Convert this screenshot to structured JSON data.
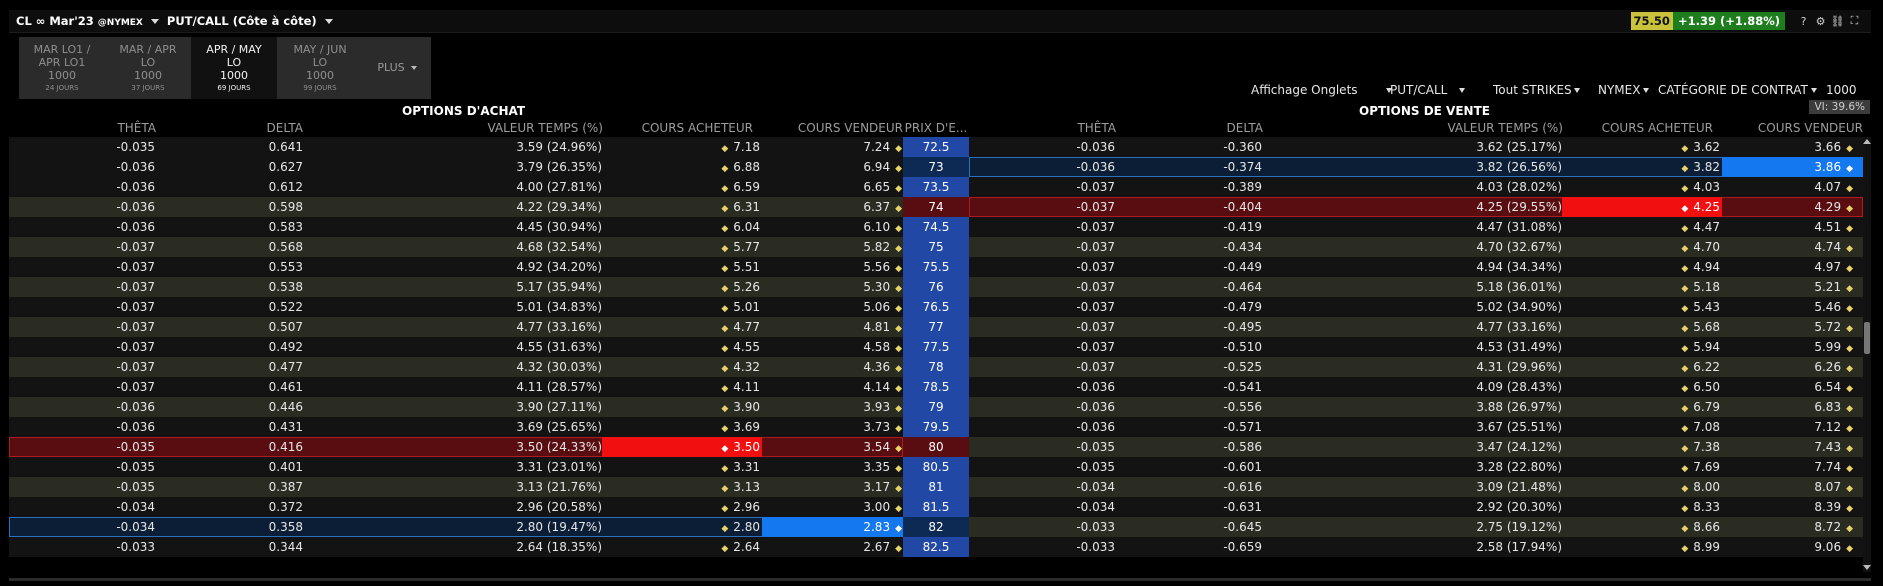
{
  "title_bar": {
    "symbol": "CL ∞ Mar'23",
    "exchange": "@NYMEX",
    "mode": "PUT/CALL (Côte à côte)",
    "last_price": "75.50",
    "change": "+1.39 (+1.88%)",
    "icons": [
      "help-icon",
      "settings-icon",
      "link-icon",
      "expand-icon"
    ],
    "help_glyph": "?",
    "settings_glyph": "⚙",
    "link_glyph": "⛓",
    "expand_glyph": "⛶"
  },
  "tabs": [
    {
      "line1": "MAR LO1 /",
      "line2": "APR LO1",
      "size": "1000",
      "days": "24 JOURS",
      "active": false
    },
    {
      "line1": "MAR / APR",
      "line2": "LO",
      "size": "1000",
      "days": "37 JOURS",
      "active": false
    },
    {
      "line1": "APR / MAY",
      "line2": "LO",
      "size": "1000",
      "days": "69 JOURS",
      "active": true
    },
    {
      "line1": "MAY / JUN",
      "line2": "LO",
      "size": "1000",
      "days": "99 JOURS",
      "active": false
    }
  ],
  "more_tab": "PLUS",
  "controls": {
    "display": "Affichage Onglets",
    "type": "PUT/CALL",
    "strikes": "Tout STRIKES",
    "exchange": "NYMEX",
    "category": "CATÉGORIE DE CONTRAT",
    "size": "1000"
  },
  "headers": {
    "calls_title": "OPTIONS D'ACHAT",
    "puts_title": "OPTIONS DE VENTE",
    "vi": "VI: 39.6%",
    "strike": "PRIX D'E...",
    "theta": "THÊTA",
    "delta": "DELTA",
    "time_value": "VALEUR TEMPS (%)",
    "bid": "COURS ACHETEUR",
    "ask": "COURS VENDEUR"
  },
  "colors": {
    "strike_bg": "#2148a4",
    "highlight_red": "#f20f0f",
    "highlight_blue": "#1479f0",
    "price_box": "#c9c23a",
    "change_box": "#1e7e1e"
  },
  "rows": [
    {
      "strike": "72.5",
      "c_theta": "-0.035",
      "c_delta": "0.641",
      "c_tv": "3.59 (24.96%)",
      "c_bid": "7.18",
      "c_ask": "7.24",
      "p_theta": "-0.036",
      "p_delta": "-0.360",
      "p_tv": "3.62 (25.17%)",
      "p_bid": "3.62",
      "p_ask": "3.66"
    },
    {
      "strike": "73",
      "c_theta": "-0.036",
      "c_delta": "0.627",
      "c_tv": "3.79 (26.35%)",
      "c_bid": "6.88",
      "c_ask": "6.94",
      "p_theta": "-0.036",
      "p_delta": "-0.374",
      "p_tv": "3.82 (26.56%)",
      "p_bid": "3.82",
      "p_ask": "3.86",
      "row_state": "put-selected",
      "p_ask_highlight": "blue"
    },
    {
      "strike": "73.5",
      "c_theta": "-0.036",
      "c_delta": "0.612",
      "c_tv": "4.00 (27.81%)",
      "c_bid": "6.59",
      "c_ask": "6.65",
      "p_theta": "-0.037",
      "p_delta": "-0.389",
      "p_tv": "4.03 (28.02%)",
      "p_bid": "4.03",
      "p_ask": "4.07"
    },
    {
      "strike": "74",
      "c_theta": "-0.036",
      "c_delta": "0.598",
      "c_tv": "4.22 (29.34%)",
      "c_bid": "6.31",
      "c_ask": "6.37",
      "p_theta": "-0.037",
      "p_delta": "-0.404",
      "p_tv": "4.25 (29.55%)",
      "p_bid": "4.25",
      "p_ask": "4.29",
      "row_state": "put-red",
      "p_bid_highlight": "red"
    },
    {
      "strike": "74.5",
      "c_theta": "-0.036",
      "c_delta": "0.583",
      "c_tv": "4.45 (30.94%)",
      "c_bid": "6.04",
      "c_ask": "6.10",
      "p_theta": "-0.037",
      "p_delta": "-0.419",
      "p_tv": "4.47 (31.08%)",
      "p_bid": "4.47",
      "p_ask": "4.51"
    },
    {
      "strike": "75",
      "c_theta": "-0.037",
      "c_delta": "0.568",
      "c_tv": "4.68 (32.54%)",
      "c_bid": "5.77",
      "c_ask": "5.82",
      "p_theta": "-0.037",
      "p_delta": "-0.434",
      "p_tv": "4.70 (32.67%)",
      "p_bid": "4.70",
      "p_ask": "4.74"
    },
    {
      "strike": "75.5",
      "c_theta": "-0.037",
      "c_delta": "0.553",
      "c_tv": "4.92 (34.20%)",
      "c_bid": "5.51",
      "c_ask": "5.56",
      "p_theta": "-0.037",
      "p_delta": "-0.449",
      "p_tv": "4.94 (34.34%)",
      "p_bid": "4.94",
      "p_ask": "4.97"
    },
    {
      "strike": "76",
      "c_theta": "-0.037",
      "c_delta": "0.538",
      "c_tv": "5.17 (35.94%)",
      "c_bid": "5.26",
      "c_ask": "5.30",
      "p_theta": "-0.037",
      "p_delta": "-0.464",
      "p_tv": "5.18 (36.01%)",
      "p_bid": "5.18",
      "p_ask": "5.21"
    },
    {
      "strike": "76.5",
      "c_theta": "-0.037",
      "c_delta": "0.522",
      "c_tv": "5.01 (34.83%)",
      "c_bid": "5.01",
      "c_ask": "5.06",
      "p_theta": "-0.037",
      "p_delta": "-0.479",
      "p_tv": "5.02 (34.90%)",
      "p_bid": "5.43",
      "p_ask": "5.46"
    },
    {
      "strike": "77",
      "c_theta": "-0.037",
      "c_delta": "0.507",
      "c_tv": "4.77 (33.16%)",
      "c_bid": "4.77",
      "c_ask": "4.81",
      "p_theta": "-0.037",
      "p_delta": "-0.495",
      "p_tv": "4.77 (33.16%)",
      "p_bid": "5.68",
      "p_ask": "5.72"
    },
    {
      "strike": "77.5",
      "c_theta": "-0.037",
      "c_delta": "0.492",
      "c_tv": "4.55 (31.63%)",
      "c_bid": "4.55",
      "c_ask": "4.58",
      "p_theta": "-0.037",
      "p_delta": "-0.510",
      "p_tv": "4.53 (31.49%)",
      "p_bid": "5.94",
      "p_ask": "5.99"
    },
    {
      "strike": "78",
      "c_theta": "-0.037",
      "c_delta": "0.477",
      "c_tv": "4.32 (30.03%)",
      "c_bid": "4.32",
      "c_ask": "4.36",
      "p_theta": "-0.037",
      "p_delta": "-0.525",
      "p_tv": "4.31 (29.96%)",
      "p_bid": "6.22",
      "p_ask": "6.26"
    },
    {
      "strike": "78.5",
      "c_theta": "-0.037",
      "c_delta": "0.461",
      "c_tv": "4.11 (28.57%)",
      "c_bid": "4.11",
      "c_ask": "4.14",
      "p_theta": "-0.036",
      "p_delta": "-0.541",
      "p_tv": "4.09 (28.43%)",
      "p_bid": "6.50",
      "p_ask": "6.54"
    },
    {
      "strike": "79",
      "c_theta": "-0.036",
      "c_delta": "0.446",
      "c_tv": "3.90 (27.11%)",
      "c_bid": "3.90",
      "c_ask": "3.93",
      "p_theta": "-0.036",
      "p_delta": "-0.556",
      "p_tv": "3.88 (26.97%)",
      "p_bid": "6.79",
      "p_ask": "6.83"
    },
    {
      "strike": "79.5",
      "c_theta": "-0.036",
      "c_delta": "0.431",
      "c_tv": "3.69 (25.65%)",
      "c_bid": "3.69",
      "c_ask": "3.73",
      "p_theta": "-0.036",
      "p_delta": "-0.571",
      "p_tv": "3.67 (25.51%)",
      "p_bid": "7.08",
      "p_ask": "7.12"
    },
    {
      "strike": "80",
      "c_theta": "-0.035",
      "c_delta": "0.416",
      "c_tv": "3.50 (24.33%)",
      "c_bid": "3.50",
      "c_ask": "3.54",
      "p_theta": "-0.035",
      "p_delta": "-0.586",
      "p_tv": "3.47 (24.12%)",
      "p_bid": "7.38",
      "p_ask": "7.43",
      "row_state": "call-red",
      "c_bid_highlight": "red"
    },
    {
      "strike": "80.5",
      "c_theta": "-0.035",
      "c_delta": "0.401",
      "c_tv": "3.31 (23.01%)",
      "c_bid": "3.31",
      "c_ask": "3.35",
      "p_theta": "-0.035",
      "p_delta": "-0.601",
      "p_tv": "3.28 (22.80%)",
      "p_bid": "7.69",
      "p_ask": "7.74"
    },
    {
      "strike": "81",
      "c_theta": "-0.035",
      "c_delta": "0.387",
      "c_tv": "3.13 (21.76%)",
      "c_bid": "3.13",
      "c_ask": "3.17",
      "p_theta": "-0.034",
      "p_delta": "-0.616",
      "p_tv": "3.09 (21.48%)",
      "p_bid": "8.00",
      "p_ask": "8.07"
    },
    {
      "strike": "81.5",
      "c_theta": "-0.034",
      "c_delta": "0.372",
      "c_tv": "2.96 (20.58%)",
      "c_bid": "2.96",
      "c_ask": "3.00",
      "p_theta": "-0.034",
      "p_delta": "-0.631",
      "p_tv": "2.92 (20.30%)",
      "p_bid": "8.33",
      "p_ask": "8.39"
    },
    {
      "strike": "82",
      "c_theta": "-0.034",
      "c_delta": "0.358",
      "c_tv": "2.80 (19.47%)",
      "c_bid": "2.80",
      "c_ask": "2.83",
      "p_theta": "-0.033",
      "p_delta": "-0.645",
      "p_tv": "2.75 (19.12%)",
      "p_bid": "8.66",
      "p_ask": "8.72",
      "row_state": "call-selected",
      "c_ask_highlight": "blue"
    },
    {
      "strike": "82.5",
      "c_theta": "-0.033",
      "c_delta": "0.344",
      "c_tv": "2.64 (18.35%)",
      "c_bid": "2.64",
      "c_ask": "2.67",
      "p_theta": "-0.033",
      "p_delta": "-0.659",
      "p_tv": "2.58 (17.94%)",
      "p_bid": "8.99",
      "p_ask": "9.06"
    }
  ]
}
